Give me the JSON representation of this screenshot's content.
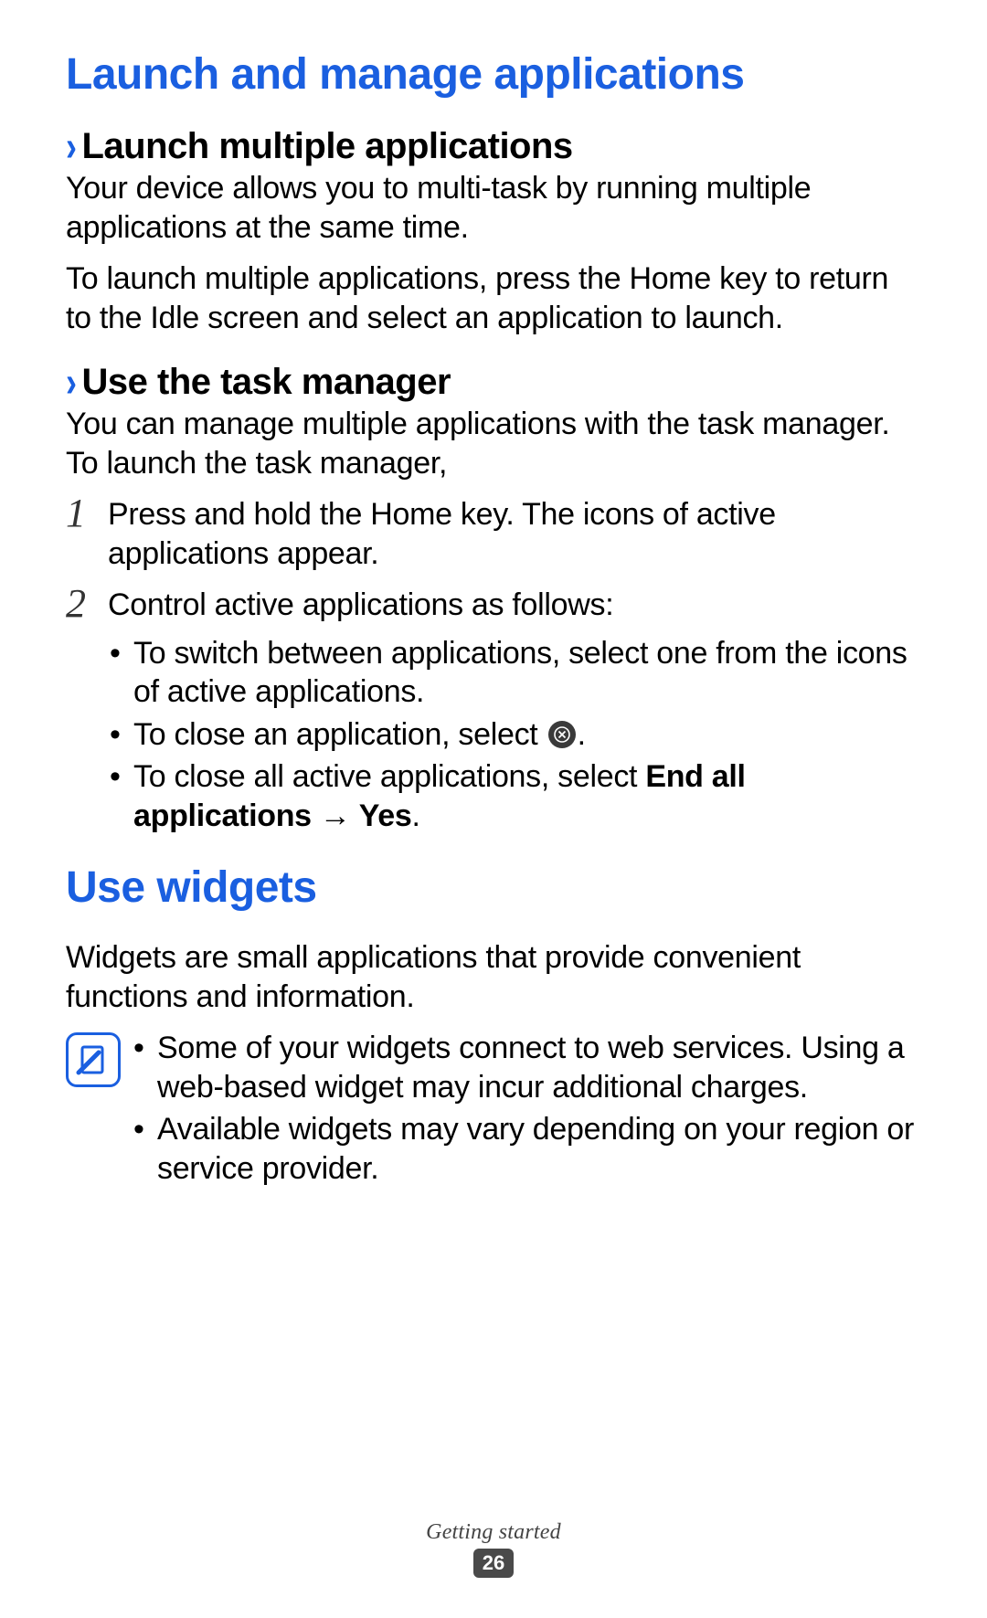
{
  "doc": {
    "h1_a": "Launch and manage applications",
    "sec_a": {
      "title": "Launch multiple applications",
      "p1": "Your device allows you to multi-task by running multiple applications at the same time.",
      "p2": "To launch multiple applications, press the Home key to return to the Idle screen and select an application to launch."
    },
    "sec_b": {
      "title": "Use the task manager",
      "p1": "You can manage multiple applications with the task manager. To launch the task manager,",
      "steps": {
        "n1": "1",
        "t1": "Press and hold the Home key. The icons of active applications appear.",
        "n2": "2",
        "t2": "Control active applications as follows:",
        "b1": "To switch between applications, select one from the icons of active applications.",
        "b2a": "To close an application, select ",
        "b2b": ".",
        "b3a": "To close all active applications, select ",
        "b3b": "End all applications",
        "b3c": " → ",
        "b3d": "Yes",
        "b3e": "."
      }
    },
    "h1_b": "Use widgets",
    "sec_c": {
      "p1": "Widgets are small applications that provide convenient functions and information.",
      "note_b1": "Some of your widgets connect to web services. Using a web-based widget may incur additional charges.",
      "note_b2": "Available widgets may vary depending on your region or service provider."
    },
    "footer": {
      "section": "Getting started",
      "page": "26"
    }
  }
}
